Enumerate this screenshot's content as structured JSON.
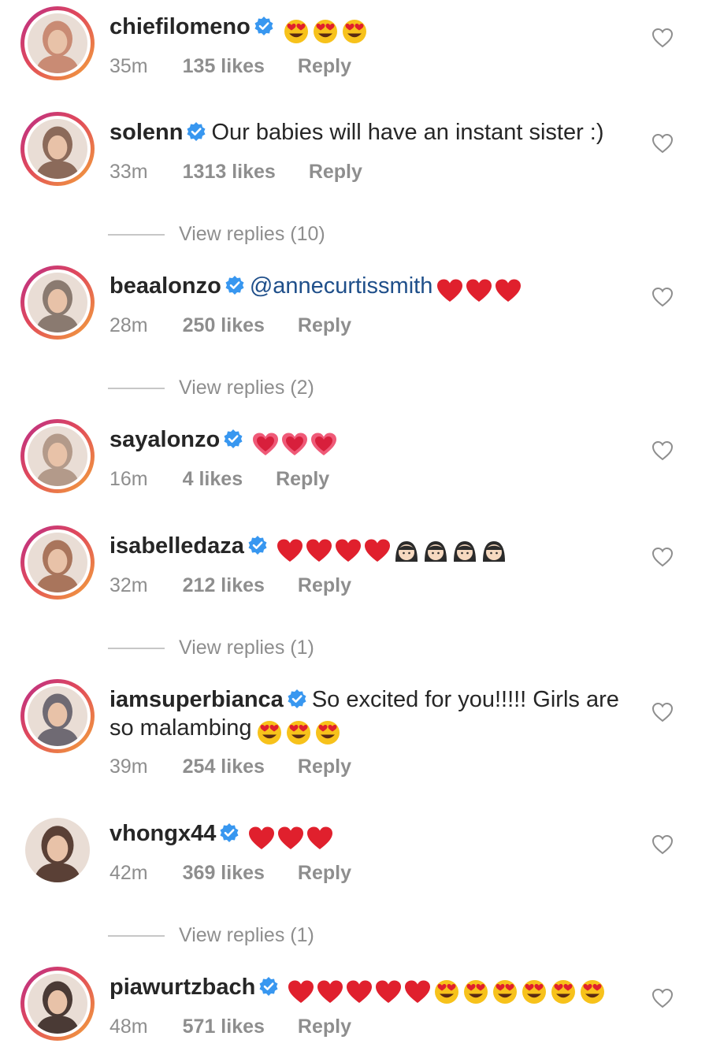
{
  "comments": [
    {
      "username": "chiefilomeno",
      "text": "",
      "emojis": [
        "heart-eyes-emoji",
        "heart-eyes-emoji",
        "heart-eyes-emoji"
      ],
      "time": "35m",
      "likes": "135 likes",
      "reply": "Reply",
      "view_replies": "",
      "avatar_color": "#c98b74"
    },
    {
      "username": "solenn",
      "text": "Our babies will have an instant sister :)",
      "emojis": [],
      "time": "33m",
      "likes": "1313 likes",
      "reply": "Reply",
      "view_replies": "View replies (10)",
      "avatar_color": "#8b6a5a"
    },
    {
      "username": "beaalonzo",
      "text": "",
      "mention": "@annecurtissmith",
      "emojis": [
        "red-heart-emoji",
        "red-heart-emoji",
        "red-heart-emoji"
      ],
      "time": "28m",
      "likes": "250 likes",
      "reply": "Reply",
      "view_replies": "View replies (2)",
      "avatar_color": "#8a7a70"
    },
    {
      "username": "sayalonzo",
      "text": "",
      "emojis": [
        "pink-heart-emoji",
        "pink-heart-emoji",
        "pink-heart-emoji"
      ],
      "time": "16m",
      "likes": "4 likes",
      "reply": "Reply",
      "view_replies": "",
      "avatar_color": "#b39a8a"
    },
    {
      "username": "isabelledaza",
      "text": "",
      "emojis": [
        "red-heart-emoji",
        "red-heart-emoji",
        "red-heart-emoji",
        "red-heart-emoji",
        "girl-emoji",
        "girl-emoji",
        "girl-emoji",
        "girl-emoji"
      ],
      "time": "32m",
      "likes": "212 likes",
      "reply": "Reply",
      "view_replies": "View replies (1)",
      "avatar_color": "#a9755c"
    },
    {
      "username": "iamsuperbianca",
      "text": "So excited for you!!!!! Girls are so malambing",
      "emojis": [
        "heart-eyes-emoji",
        "heart-eyes-emoji",
        "heart-eyes-emoji"
      ],
      "time": "39m",
      "likes": "254 likes",
      "reply": "Reply",
      "view_replies": "",
      "avatar_color": "#6f6a73"
    },
    {
      "username": "vhongx44",
      "text": "",
      "emojis": [
        "red-heart-emoji",
        "red-heart-emoji",
        "red-heart-emoji"
      ],
      "time": "42m",
      "likes": "369 likes",
      "reply": "Reply",
      "view_replies": "View replies (1)",
      "avatar_color": "#5a4036"
    },
    {
      "username": "piawurtzbach",
      "text": "",
      "emojis": [
        "red-heart-emoji",
        "red-heart-emoji",
        "red-heart-emoji",
        "red-heart-emoji",
        "red-heart-emoji",
        "heart-eyes-emoji",
        "heart-eyes-emoji",
        "heart-eyes-emoji",
        "heart-eyes-emoji",
        "heart-eyes-emoji",
        "heart-eyes-emoji"
      ],
      "time": "48m",
      "likes": "571 likes",
      "reply": "Reply",
      "view_replies": "",
      "avatar_color": "#4a3a35"
    }
  ],
  "colors": {
    "verified": "#3897f0",
    "mention": "#1f4f8a",
    "meta": "#8e8e8e",
    "heart": "#e0202d"
  }
}
